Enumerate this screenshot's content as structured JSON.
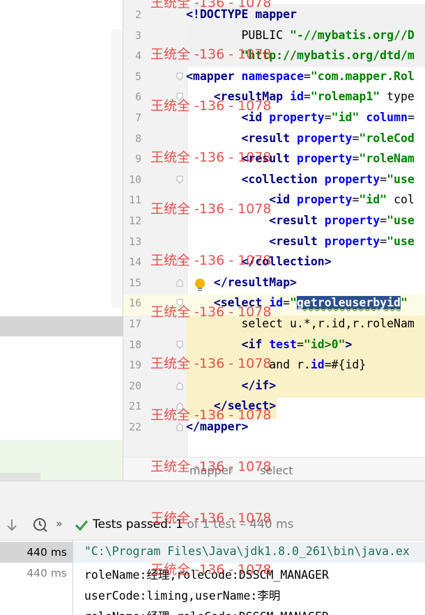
{
  "editor": {
    "lines": [
      {
        "num": "2",
        "text": "<!DOCTYPE mapper"
      },
      {
        "num": "3",
        "text": "        PUBLIC \"-//mybatis.org//D"
      },
      {
        "num": "4",
        "text": "        \"http://mybatis.org/dtd/m"
      },
      {
        "num": "5",
        "text": "<mapper namespace=\"com.mapper.Rol"
      },
      {
        "num": "6",
        "text": "    <resultMap id=\"rolemap1\" type"
      },
      {
        "num": "7",
        "text": "        <id property=\"id\" column="
      },
      {
        "num": "8",
        "text": "        <result property=\"roleCod"
      },
      {
        "num": "9",
        "text": "        <result property=\"roleNam"
      },
      {
        "num": "10",
        "text": "        <collection property=\"use"
      },
      {
        "num": "11",
        "text": "            <id property=\"id\" col"
      },
      {
        "num": "12",
        "text": "            <result property=\"use"
      },
      {
        "num": "13",
        "text": "            <result property=\"use"
      },
      {
        "num": "14",
        "text": "        </collection>"
      },
      {
        "num": "15",
        "text": "    </resultMap>"
      },
      {
        "num": "16",
        "text": "    <select id=\"getroleuserbyid\""
      },
      {
        "num": "17",
        "text": "        select u.*,r.id,r.roleNam"
      },
      {
        "num": "18",
        "text": "        <if test=\"id>0\">"
      },
      {
        "num": "19",
        "text": "            and r.id=#{id}"
      },
      {
        "num": "20",
        "text": "        </if>"
      },
      {
        "num": "21",
        "text": "    </select>"
      },
      {
        "num": "22",
        "text": "</mapper>"
      }
    ],
    "selected_word": "getroleuserbyid",
    "bulb_icon": "intention-bulb-icon"
  },
  "breadcrumb": {
    "items": [
      "mapper",
      "select"
    ],
    "separator": "›"
  },
  "run": {
    "toolbar": {
      "more": "»",
      "status_passed": "Tests passed: ",
      "status_count": "1",
      "status_rest": " of 1 test – 440 ms"
    },
    "tree": [
      "440 ms",
      "440 ms"
    ],
    "console": [
      "\"C:\\Program Files\\Java\\jdk1.8.0_261\\bin\\java.ex",
      "roleName:经理,roleCode:DSSCM_MANAGER",
      "userCode:liming,userName:李明",
      "roleName:经理,roleCode:DSSCM_MANAGER"
    ]
  },
  "watermark": "王统全 -136 - 1078",
  "colors": {
    "tag": "#000080",
    "attr": "#0000ff",
    "value": "#008000",
    "selection": "#2a4f8f",
    "pass_green": "#3c9a4a",
    "watermark": "#e62828"
  }
}
